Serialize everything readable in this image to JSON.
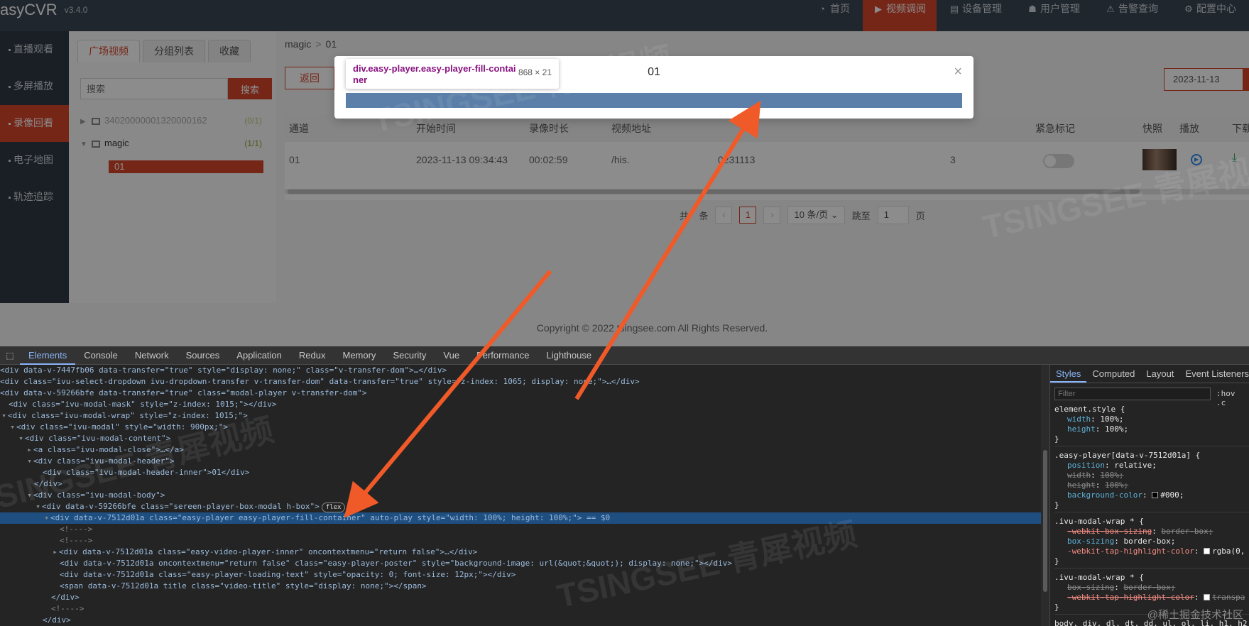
{
  "app": {
    "logo": "asyCVR",
    "version": "v3.4.0",
    "nav": [
      {
        "icon": "dashboard-icon",
        "label": "首页"
      },
      {
        "icon": "video-icon",
        "label": "视频调阅"
      },
      {
        "icon": "device-icon",
        "label": "设备管理"
      },
      {
        "icon": "user-icon",
        "label": "用户管理"
      },
      {
        "icon": "alarm-icon",
        "label": "告警查询"
      },
      {
        "icon": "gear-icon",
        "label": "配置中心"
      }
    ],
    "sidebar": [
      "直播观看",
      "多屏播放",
      "录像回看",
      "电子地图",
      "轨迹追踪"
    ],
    "tabs": [
      "广场视频",
      "分组列表",
      "收藏"
    ],
    "search": {
      "placeholder": "搜索",
      "button": "搜索"
    },
    "tree": [
      {
        "label": "34020000001320000162",
        "count": "(0/1)"
      },
      {
        "label": "magic",
        "count": "(1/1)"
      },
      {
        "label": "01"
      }
    ],
    "breadcrumb": {
      "root": "magic",
      "sep": ">",
      "leaf": "01"
    },
    "back_label": "返回",
    "date_value": "2023-11-13",
    "table": {
      "headers": [
        "通道",
        "开始时间",
        "录像时长",
        "视频地址",
        "紧急标记",
        "快照",
        "播放",
        "下载"
      ],
      "row": {
        "channel": "01",
        "start": "2023-11-13 09:34:43",
        "duration": "00:02:59",
        "addr_left": "/his.",
        "addr_right": "0231113",
        "extra": "3"
      }
    },
    "pager": {
      "total_prefix": "共",
      "total_suffix": "条",
      "prev": "‹",
      "page": "1",
      "next": "›",
      "page_size": "10 条/页",
      "jump_label": "跳至",
      "jump_value": "1",
      "page_suffix": "页"
    },
    "footer": "Copyright © 2022 tsingsee.com All Rights Reserved."
  },
  "modal": {
    "title": "01",
    "close": "×",
    "tooltip_name": "div.easy-player.easy-player-fill-container",
    "tooltip_size": "868 × 21"
  },
  "devtools": {
    "tabs": [
      "Elements",
      "Console",
      "Network",
      "Sources",
      "Application",
      "Redux",
      "Memory",
      "Security",
      "Vue",
      "Performance",
      "Lighthouse"
    ],
    "dom_lines": [
      "<div data-v-7447fb06 data-transfer=\"true\" style=\"display: none;\" class=\"v-transfer-dom\">…</div>",
      "<div class=\"ivu-select-dropdown ivu-dropdown-transfer v-transfer-dom\" data-transfer=\"true\" style=\"z-index: 1065; display: none;\">…</div>",
      "<div data-v-59266bfe data-transfer=\"true\" class=\"modal-player v-transfer-dom\">",
      "<div class=\"ivu-modal-mask\" style=\"z-index: 1015;\"></div>",
      "<div class=\"ivu-modal-wrap\" style=\"z-index: 1015;\">",
      "<div class=\"ivu-modal\" style=\"width: 900px;\">",
      "<div class=\"ivu-modal-content\">",
      "<a class=\"ivu-modal-close\">…</a>",
      "<div class=\"ivu-modal-header\">",
      "<div class=\"ivu-modal-header-inner\">01</div>",
      "</div>",
      "<div class=\"ivu-modal-body\">",
      "<div data-v-59266bfe class=\"sereen-player-box-modal h-box\">",
      "<div data-v-7512d01a class=\"easy-player easy-player-fill-container\" auto-play style=\"width: 100%; height: 100%;\"> == $0",
      "<!---->",
      "<!---->",
      "<div data-v-7512d01a class=\"easy-video-player-inner\" oncontextmenu=\"return false\">…</div>",
      "<div data-v-7512d01a oncontextmenu=\"return false\" class=\"easy-player-poster\" style=\"background-image: url(&quot;&quot;); display: none;\"></div>",
      "<div data-v-7512d01a class=\"easy-player-loading-text\" style=\"opacity: 0; font-size: 12px;\"></div>",
      "<span data-v-7512d01a title class=\"video-title\" style=\"display: none;\"></span>",
      "</div>",
      "<!---->",
      "</div>"
    ],
    "flex_badge": "flex",
    "styles_tabs": [
      "Styles",
      "Computed",
      "Layout",
      "Event Listeners"
    ],
    "filter_placeholder": "Filter",
    "hov": ":hov  .c",
    "style_rules": [
      {
        "selector": "element.style {",
        "props": [
          [
            "width",
            "100%;"
          ],
          [
            "height",
            "100%;"
          ]
        ]
      },
      {
        "selector": ".easy-player[data-v-7512d01a] {",
        "props": [
          [
            "position",
            "relative;"
          ],
          [
            "width",
            "100%;"
          ],
          [
            "height",
            "100%;"
          ],
          [
            "background-color",
            "#000;"
          ]
        ]
      },
      {
        "selector": ".ivu-modal-wrap * {",
        "props": [
          [
            "-webkit-box-sizing",
            "border-box;"
          ],
          [
            "box-sizing",
            "border-box;"
          ],
          [
            "-webkit-tap-highlight-color",
            "rgba(0,"
          ]
        ]
      },
      {
        "selector": ".ivu-modal-wrap * {",
        "props": [
          [
            "box-sizing",
            "border-box;"
          ],
          [
            "-webkit-tap-highlight-color",
            "transpa"
          ]
        ]
      }
    ],
    "last_selector": "body, div, dl, dt, dd, ul, ol, li, h1, h2"
  },
  "watermark": "TSINGSEE 青犀视频",
  "credit": "@稀土掘金技术社区",
  "colors": {
    "accent": "#d6452a",
    "annotation_arrow": "#f05a28",
    "devtools_bg": "#242424"
  }
}
